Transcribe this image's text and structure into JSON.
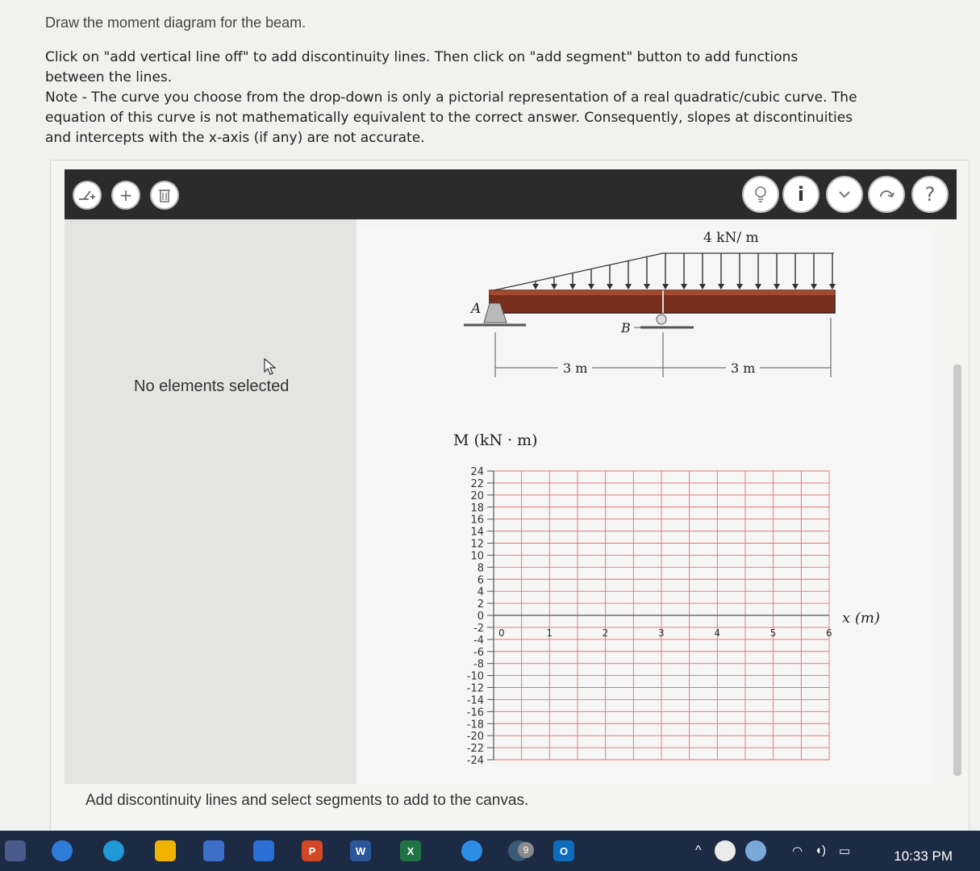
{
  "question": {
    "title": "Draw the moment diagram for the beam.",
    "line1": "Click on \"add vertical line off\" to add discontinuity lines. Then click on \"add segment\" button to add functions",
    "line2": "between the lines.",
    "line3": "Note - The curve you choose from the drop-down is only a pictorial representation of a real quadratic/cubic curve. The",
    "line4": "equation of this curve is not mathematically equivalent to the correct answer. Consequently, slopes at discontinuities",
    "line5": "and intercepts with the x-axis (if any) are not accurate."
  },
  "toolbar": {
    "left_icons": [
      "add-vertical-line-icon",
      "plus-icon",
      "trash-icon"
    ],
    "right_icons": [
      "lightbulb-icon",
      "info-icon",
      "chevron-down-icon",
      "refresh-icon",
      "help-icon"
    ],
    "info_glyph": "i",
    "help_glyph": "?",
    "plus_glyph": "+"
  },
  "left_panel": {
    "status": "No elements selected"
  },
  "beam": {
    "load_label": "4 kN/ m",
    "support_a": "A",
    "support_b": "B",
    "span1": "3 m",
    "span2": "3 m"
  },
  "chart_data": {
    "type": "line",
    "ylabel": "M (kN · m)",
    "xlabel": "x (m)",
    "xlim": [
      0,
      6
    ],
    "ylim": [
      -24,
      24
    ],
    "x_ticks": [
      0,
      1,
      2,
      3,
      4,
      5,
      6
    ],
    "y_ticks": [
      24,
      22,
      20,
      18,
      16,
      14,
      12,
      10,
      8,
      6,
      4,
      2,
      0,
      -2,
      -4,
      -6,
      -8,
      -10,
      -12,
      -14,
      -16,
      -18,
      -20,
      -22,
      -24
    ],
    "grid": true,
    "series": []
  },
  "footer": {
    "hint": "Add discontinuity lines and select segments to add to the canvas."
  },
  "taskbar": {
    "time": "10:33 PM",
    "badge": "9",
    "apps": [
      "P",
      "W",
      "X",
      "O"
    ]
  },
  "colors": {
    "grid": "#e07070",
    "toolbar": "#2b2b2b",
    "taskbar": "#1d2a44",
    "beam": "#7a2e1e"
  }
}
